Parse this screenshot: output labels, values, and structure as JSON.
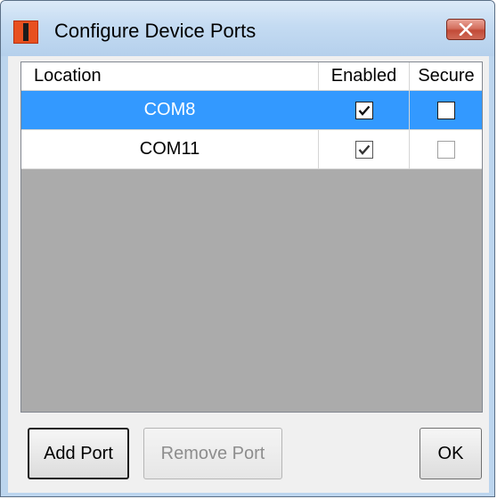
{
  "window": {
    "title": "Configure Device Ports",
    "close_label": "close"
  },
  "grid": {
    "columns": [
      "Location",
      "Enabled",
      "Secure"
    ],
    "rows": [
      {
        "location": "COM8",
        "enabled": true,
        "secure": false,
        "selected": true
      },
      {
        "location": "COM11",
        "enabled": true,
        "secure": false,
        "selected": false
      }
    ]
  },
  "buttons": {
    "add_port": "Add Port",
    "remove_port": "Remove Port",
    "ok": "OK"
  },
  "colors": {
    "selection": "#3399ff",
    "empty_area": "#ababab",
    "close_button": "#c24b38"
  },
  "icons": {
    "app": "red-app-icon",
    "close": "close-icon",
    "check": "checkmark-icon"
  }
}
